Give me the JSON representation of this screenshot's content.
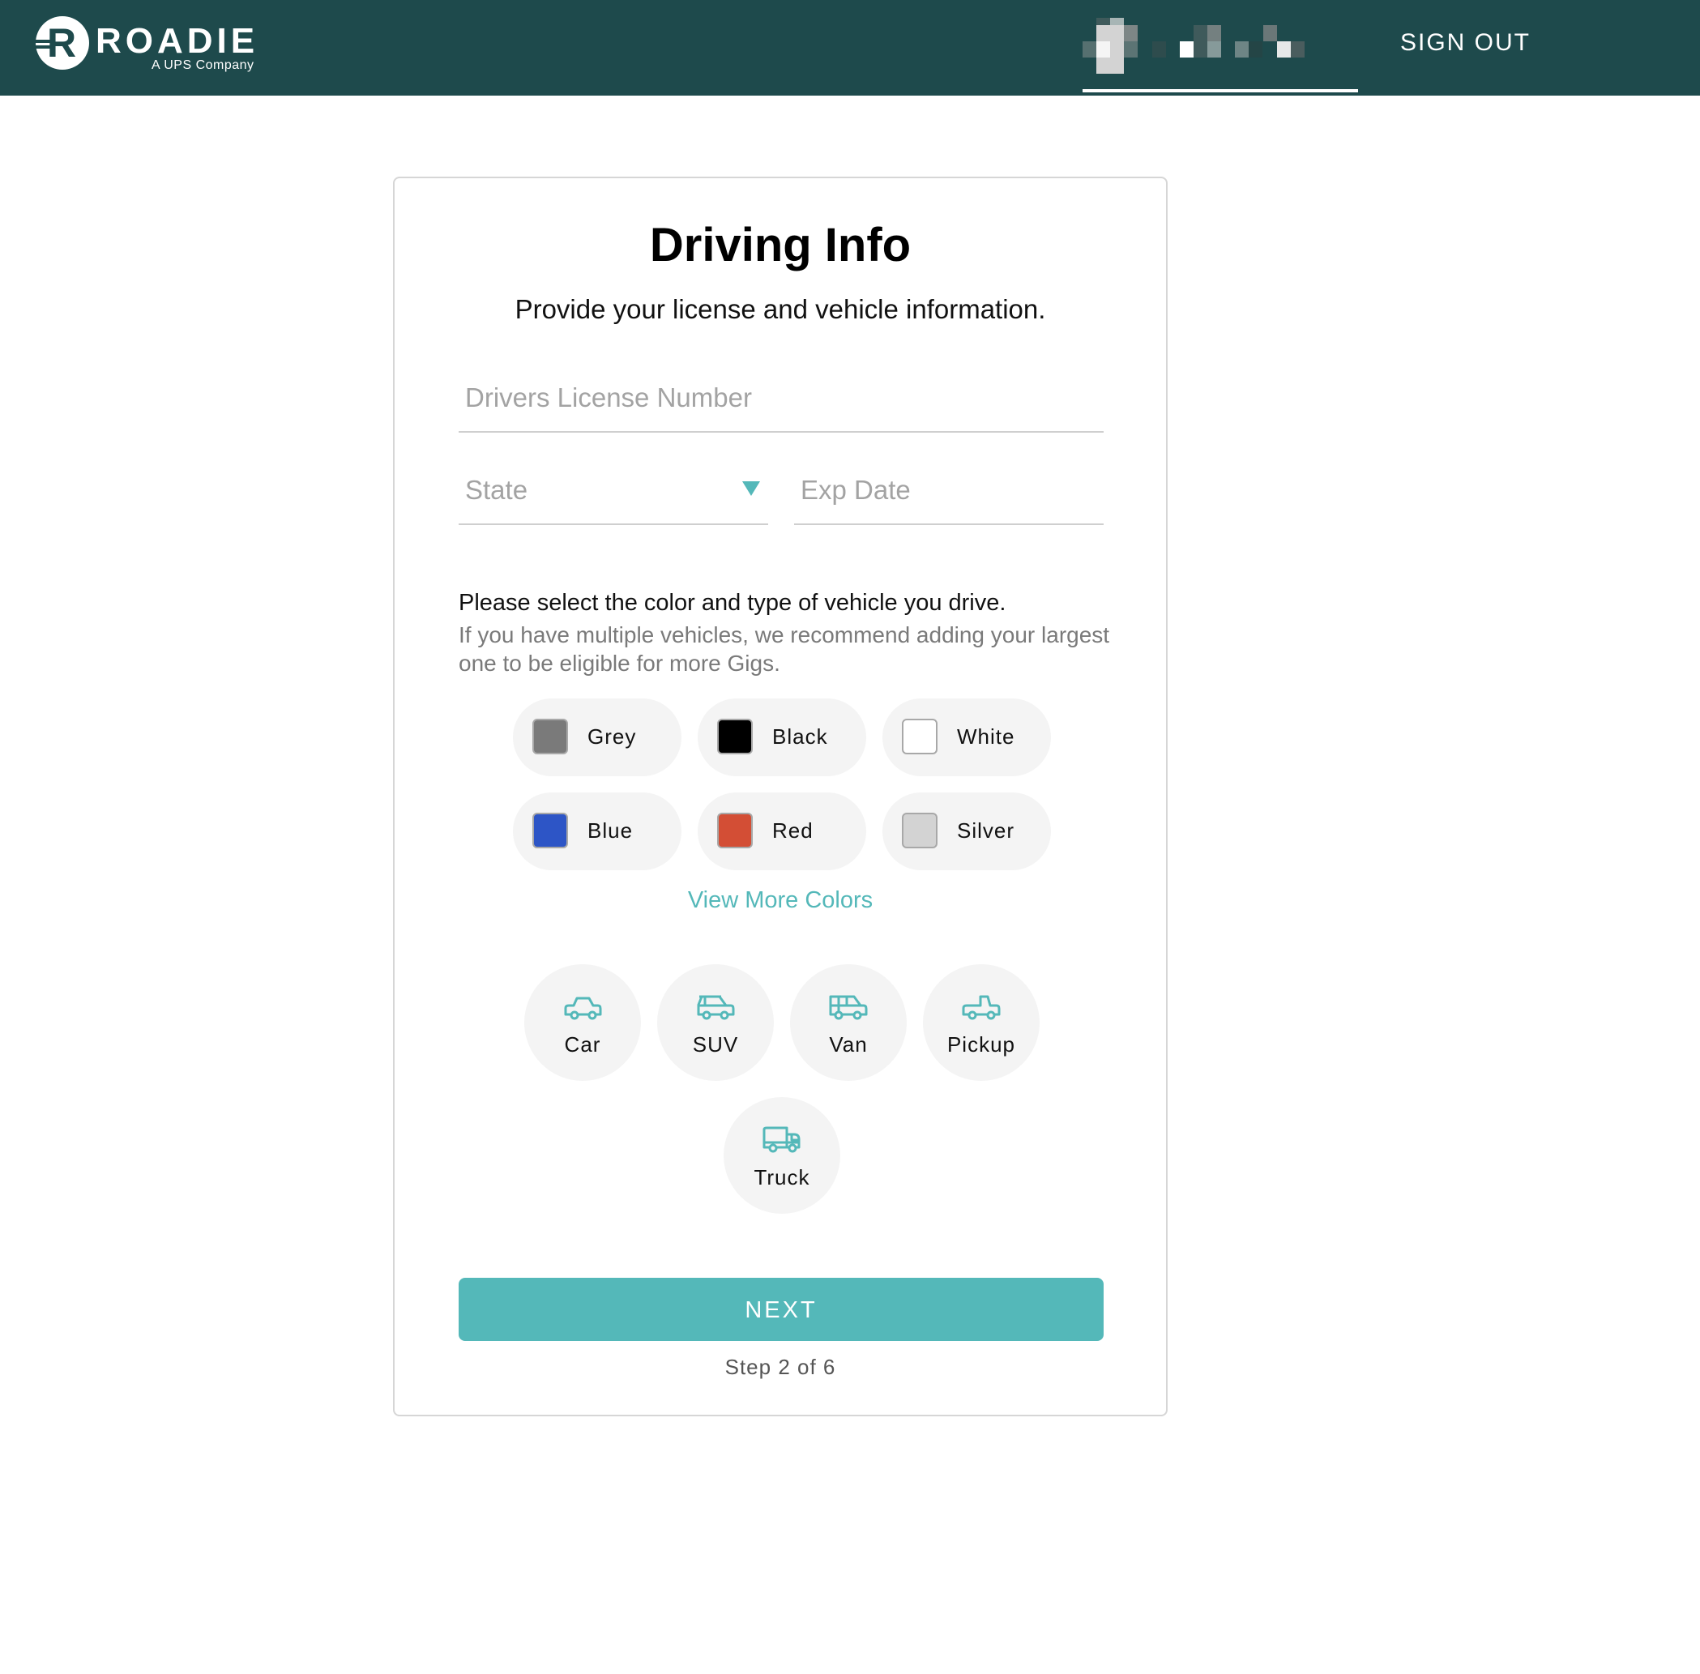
{
  "header": {
    "brand": "ROADIE",
    "brand_initial": "R",
    "brand_subtitle": "A UPS Company",
    "user_name_redacted": true,
    "sign_out_label": "SIGN OUT",
    "background_color": "#1e4a4c"
  },
  "form": {
    "title": "Driving Info",
    "subtitle": "Provide your license and vehicle information.",
    "license_field": {
      "placeholder": "Drivers License Number",
      "value": ""
    },
    "state_field": {
      "placeholder": "State",
      "value": ""
    },
    "exp_date_field": {
      "placeholder": "Exp Date",
      "value": ""
    },
    "vehicle_prompt": "Please select the color and type of vehicle you drive.",
    "vehicle_help": "If you have multiple vehicles, we recommend adding your largest one to be eligible for more Gigs.",
    "colors": [
      {
        "label": "Grey",
        "hex": "#7a7a7a"
      },
      {
        "label": "Black",
        "hex": "#000000"
      },
      {
        "label": "White",
        "hex": "#ffffff"
      },
      {
        "label": "Blue",
        "hex": "#2d55c6"
      },
      {
        "label": "Red",
        "hex": "#d34e35"
      },
      {
        "label": "Silver",
        "hex": "#d3d3d3"
      }
    ],
    "view_more_colors_label": "View More Colors",
    "vehicle_types": [
      {
        "label": "Car",
        "icon": "car-icon"
      },
      {
        "label": "SUV",
        "icon": "suv-icon"
      },
      {
        "label": "Van",
        "icon": "van-icon"
      },
      {
        "label": "Pickup",
        "icon": "pickup-icon"
      },
      {
        "label": "Truck",
        "icon": "truck-icon"
      }
    ],
    "next_label": "NEXT",
    "step_text": "Step 2 of 6",
    "accent_color": "#54b8b9"
  }
}
